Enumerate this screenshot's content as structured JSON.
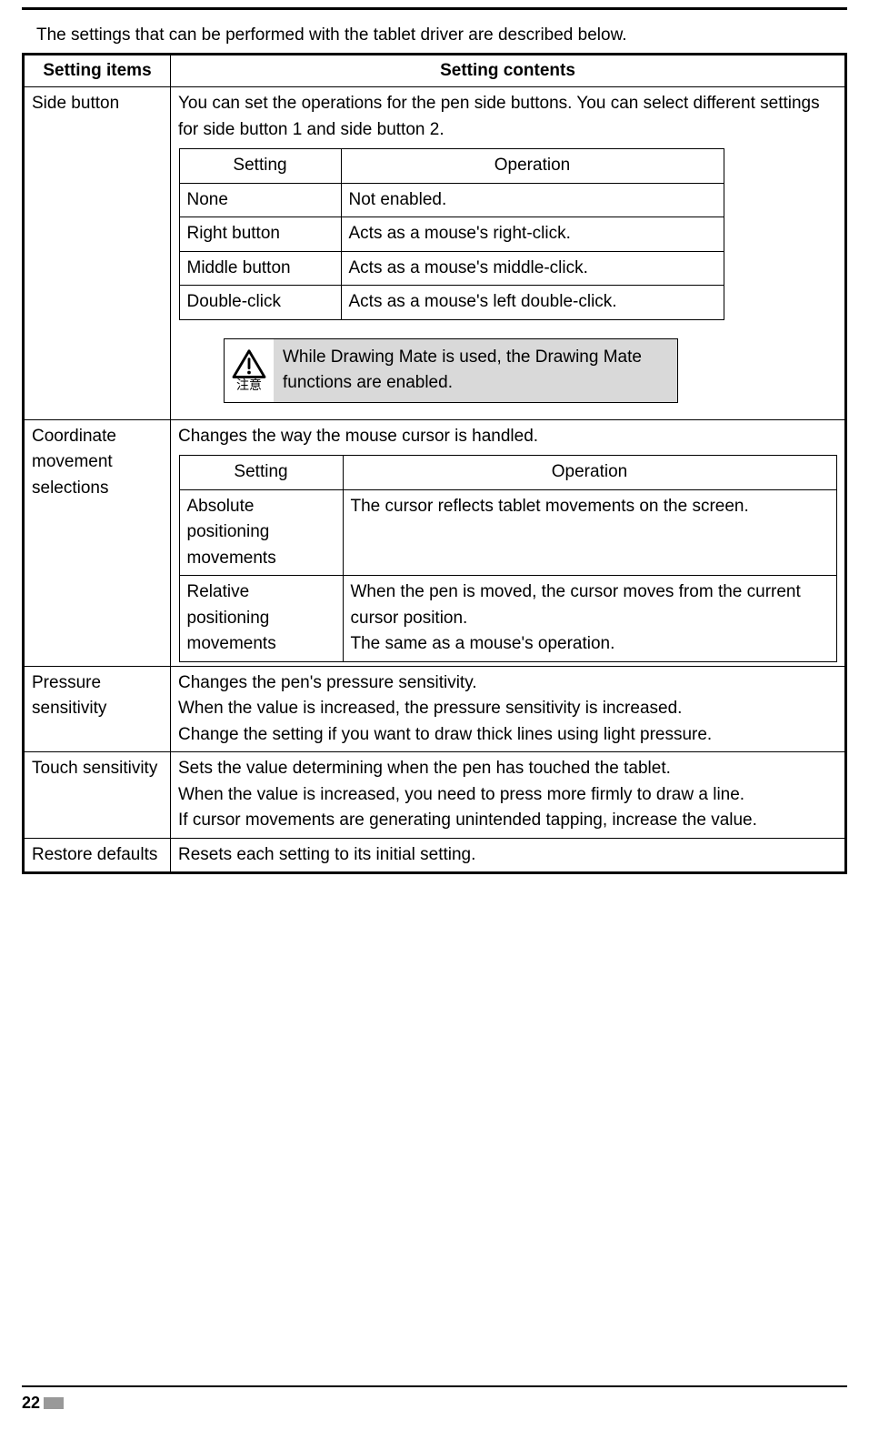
{
  "intro": "The settings that can be performed with the tablet driver are described below.",
  "headers": {
    "items": "Setting items",
    "contents": "Setting contents"
  },
  "rows": {
    "side_button": {
      "label": "Side button",
      "desc": "You can set the operations for the pen side buttons. You can select different settings for side button 1 and side button 2.",
      "th_setting": "Setting",
      "th_operation": "Operation",
      "r0s": "None",
      "r0o": "Not enabled.",
      "r1s": "Right button",
      "r1o": "Acts as a mouse's right-click.",
      "r2s": "Middle button",
      "r2o": "Acts as a mouse's middle-click.",
      "r3s": "Double-click",
      "r3o": "Acts as a mouse's left double-click.",
      "notice_label": "注意",
      "notice_text": "While Drawing Mate is used, the Drawing Mate functions are enabled."
    },
    "coord": {
      "label": "Coordinate movement selections",
      "desc": "Changes the way the mouse cursor is handled.",
      "th_setting": "Setting",
      "th_operation": "Operation",
      "r0s": "Absolute positioning movements",
      "r0o": "The cursor reflects tablet movements on the screen.",
      "r1s": "Relative positioning movements",
      "r1o": "When the pen is moved, the cursor moves from the current cursor position.\nThe same as a mouse's operation."
    },
    "pressure": {
      "label": "Pressure sensitivity",
      "desc": "Changes the pen's pressure sensitivity.\nWhen the value is increased, the pressure sensitivity is increased.\nChange the setting if you want to draw thick lines using light pressure."
    },
    "touch": {
      "label": "Touch sensitivity",
      "desc": "Sets the value determining when the pen has touched the tablet.\nWhen the value is increased, you need to press more firmly to draw a line.\nIf cursor movements are generating unintended tapping, increase the value."
    },
    "restore": {
      "label": "Restore defaults",
      "desc": "Resets each setting to its initial setting."
    }
  },
  "page_number": "22"
}
